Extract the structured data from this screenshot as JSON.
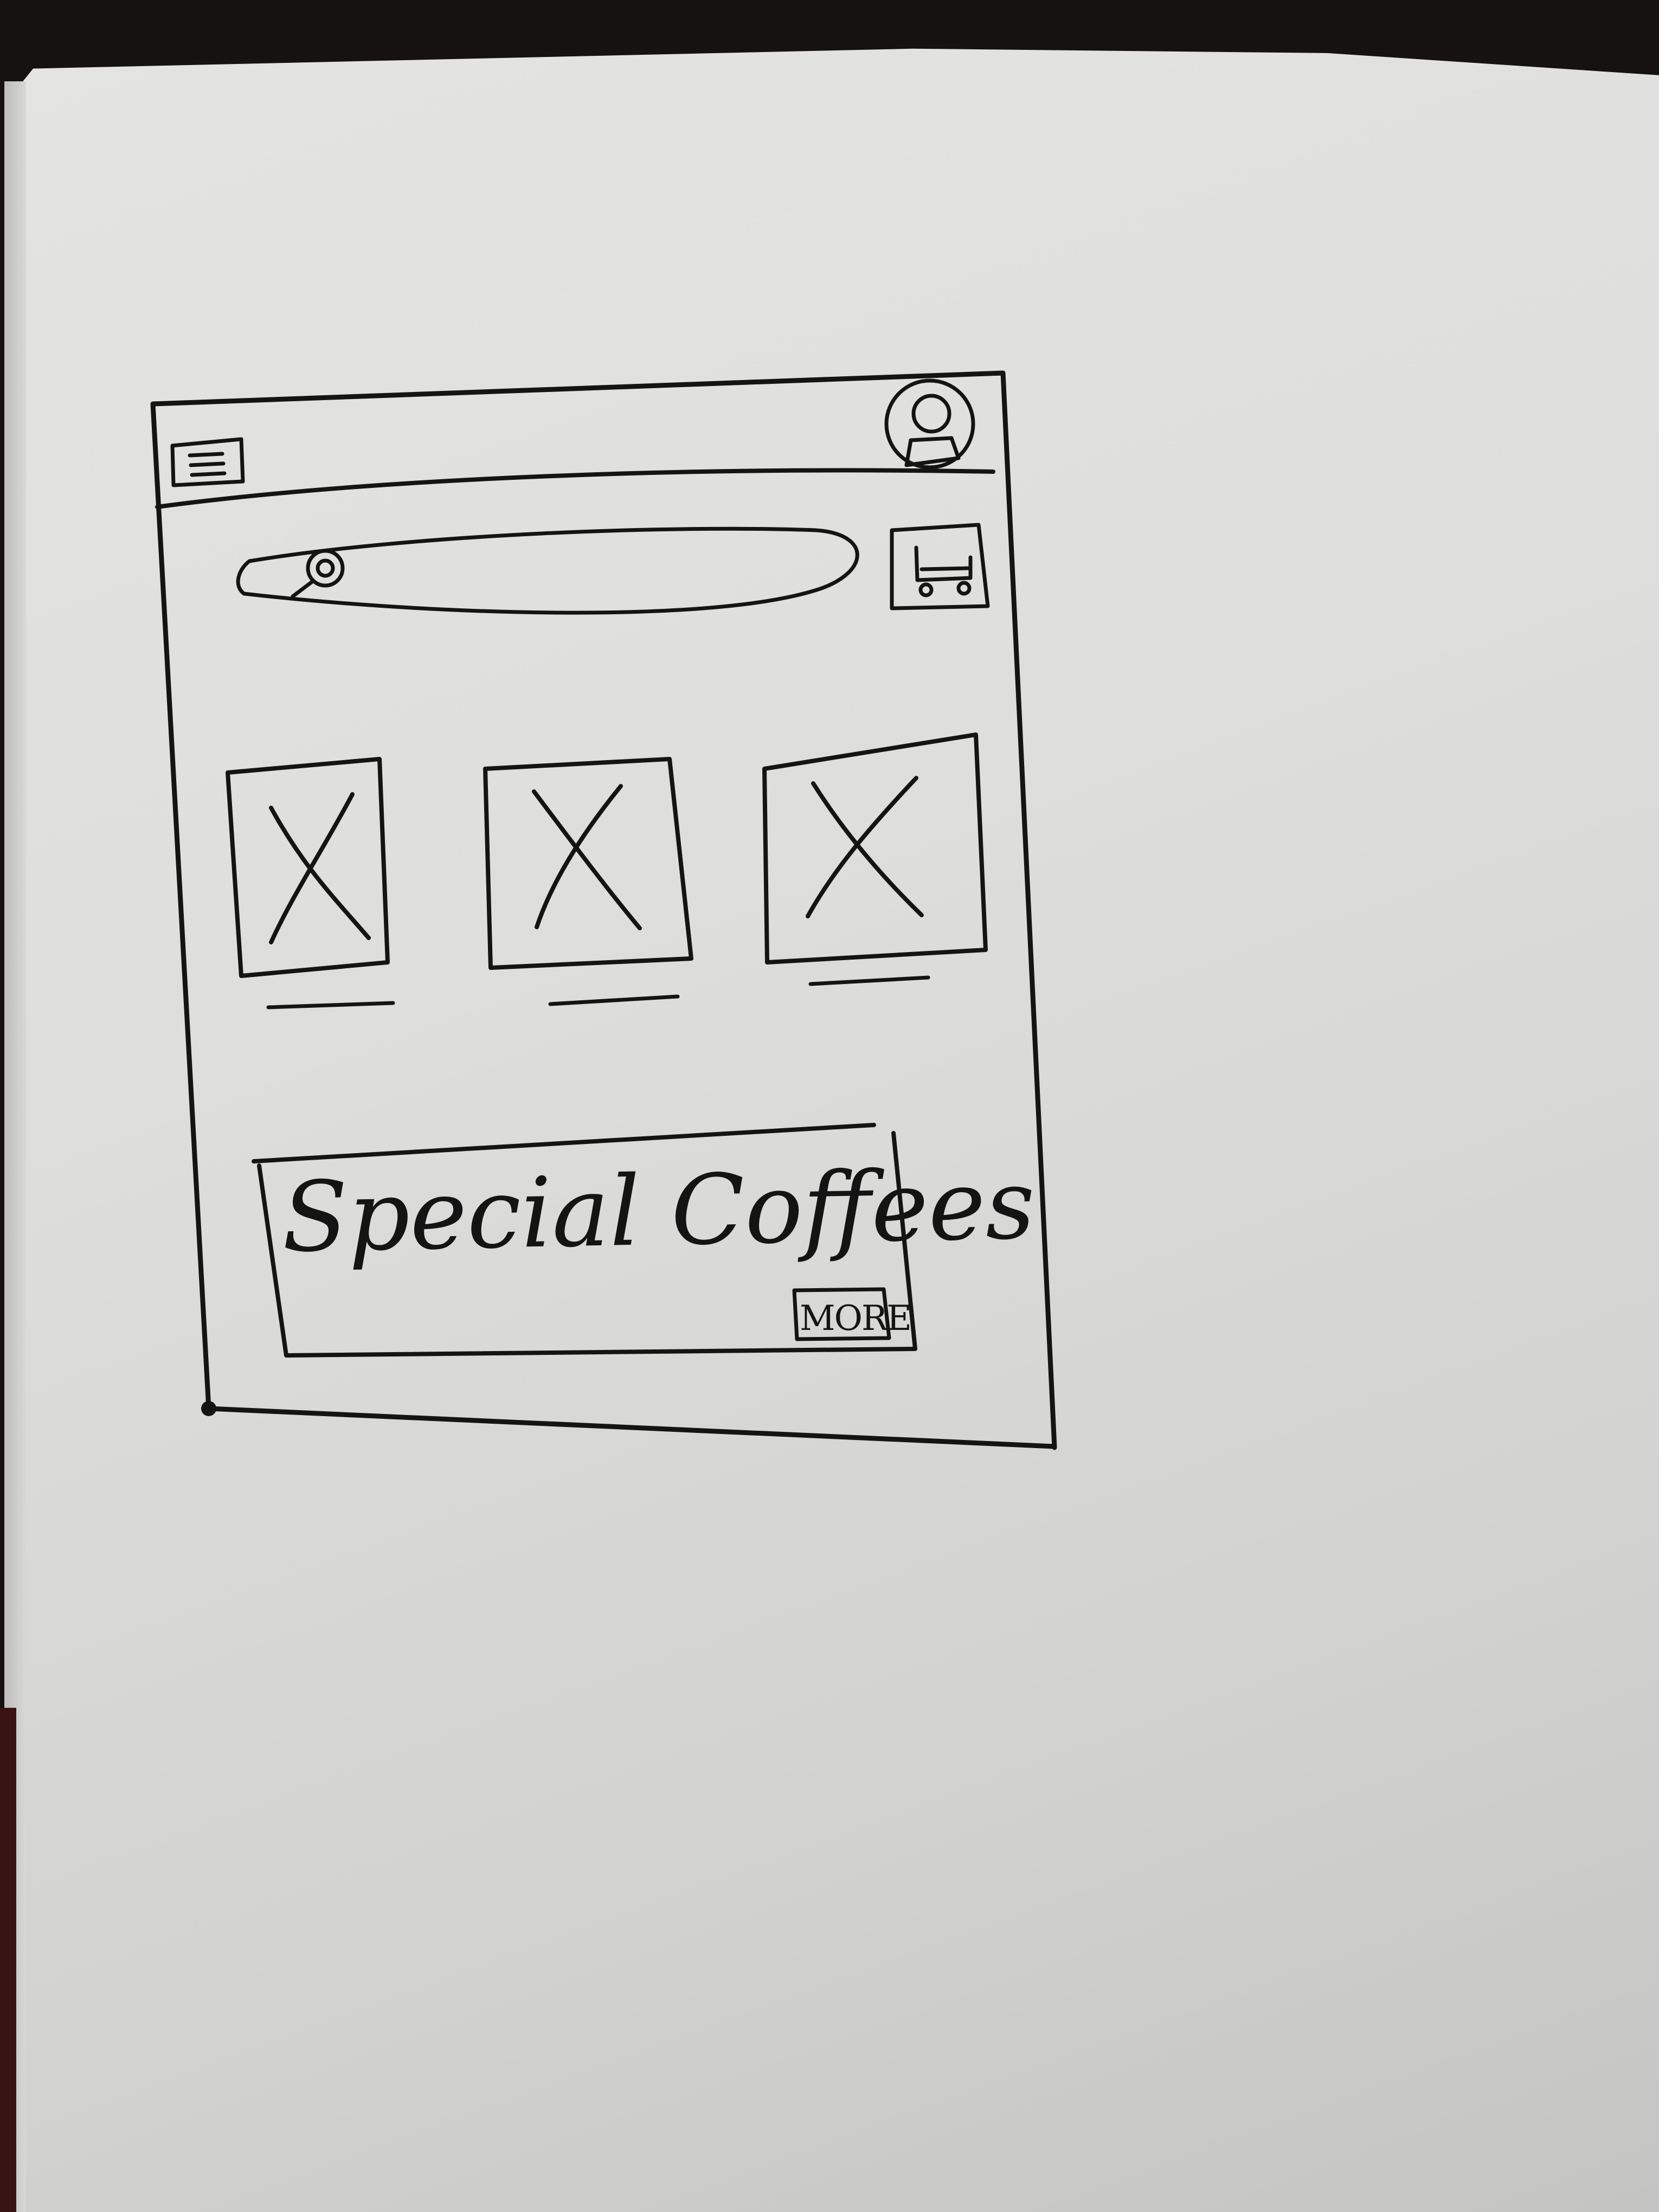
{
  "icons": {
    "menu": "hamburger-menu-icon",
    "profile": "user-avatar-icon",
    "search": "magnifier-icon",
    "cart": "shopping-cart-icon",
    "placeholder_image": "image-placeholder-x-icon"
  },
  "products": [
    {
      "caption": ""
    },
    {
      "caption": ""
    },
    {
      "caption": ""
    }
  ],
  "banner": {
    "title": "Special Coffees",
    "more_label": "MORE"
  },
  "colors": {
    "ink": "#141414",
    "paper": "#dededc"
  }
}
